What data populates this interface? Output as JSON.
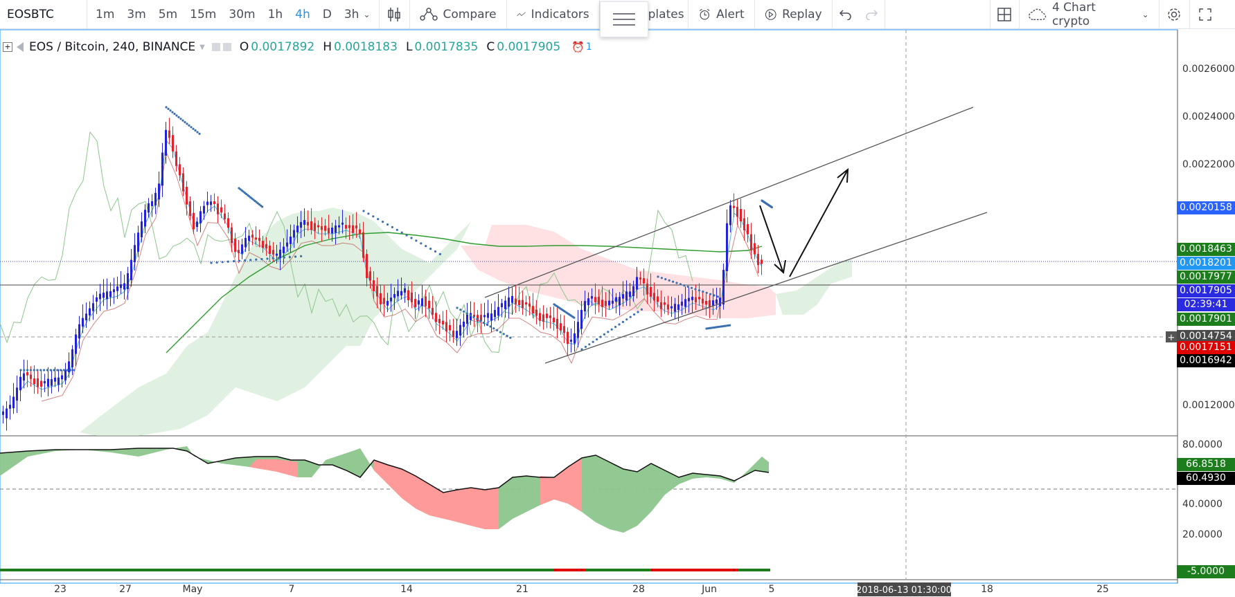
{
  "toolbar": {
    "symbol": "EOSBTC",
    "intervals": [
      "1m",
      "3m",
      "5m",
      "15m",
      "30m",
      "1h",
      "4h",
      "D",
      "3h"
    ],
    "active_interval": "4h",
    "compare_label": "Compare",
    "indicators_label": "Indicators",
    "templates_label": "plates",
    "alert_label": "Alert",
    "replay_label": "Replay",
    "layout_name": "4 Chart crypto"
  },
  "legend": {
    "title": "EOS / Bitcoin, 240, BINANCE",
    "o_label": "O",
    "o_value": "0.0017892",
    "h_label": "H",
    "h_value": "0.0018183",
    "l_label": "L",
    "l_value": "0.0017835",
    "c_label": "C",
    "c_value": "0.0017905",
    "alert_count": "1"
  },
  "price_axis": {
    "ticks": [
      "0.0026000",
      "0.0024000",
      "0.0022000",
      "0.0012000"
    ],
    "badges": [
      {
        "text": "0.0020158",
        "color": "#2962ff"
      },
      {
        "text": "0.0018463",
        "color": "#1b7d1b"
      },
      {
        "text": "0.0018201",
        "color": "#2196f3"
      },
      {
        "text": "0.0017977",
        "color": "#1b7d1b"
      },
      {
        "text": "0.0017905",
        "color": "#2a2ae0"
      },
      {
        "text": "02:39:41",
        "color": "#2a2ae0"
      },
      {
        "text": "0.0017901",
        "color": "#1b7d1b"
      },
      {
        "text": "0.0014754",
        "color": "#4a4a4a"
      },
      {
        "text": "0.0017151",
        "color": "#e00000"
      },
      {
        "text": "0.0016942",
        "color": "#000000"
      }
    ]
  },
  "osc_axis": {
    "ticks": [
      "80.0000",
      "40.0000",
      "20.0000"
    ],
    "badges": [
      {
        "text": "66.8518",
        "color": "#1b7d1b"
      },
      {
        "text": "60.4930",
        "color": "#000000"
      },
      {
        "text": "-5.0000",
        "color": "#1b7d1b"
      }
    ]
  },
  "time_axis": {
    "labels": [
      "23",
      "27",
      "May",
      "7",
      "14",
      "21",
      "28",
      "Jun",
      "5",
      "18",
      "25"
    ],
    "crosshair_label": "2018-06-13 01:30:00"
  },
  "colors": {
    "up": "#2222dd",
    "down": "#e8202a",
    "cloud_green": "#c8e6c9",
    "cloud_red": "#ffcdd2",
    "osc_green": "#8cc68c",
    "osc_red": "#ff9a9a"
  }
}
